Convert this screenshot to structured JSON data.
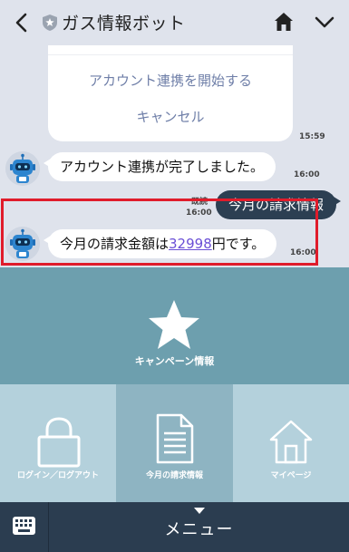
{
  "header": {
    "title": "ガス情報ボット"
  },
  "chat": {
    "card": {
      "action_start": "アカウント連携を開始する",
      "action_cancel": "キャンセル",
      "time": "15:59"
    },
    "messages": [
      {
        "from": "bot",
        "text": "アカウント連携が完了しました。",
        "time": "16:00"
      },
      {
        "from": "user",
        "text": "今月の請求情報",
        "read": "既読",
        "time": "16:00"
      },
      {
        "from": "bot",
        "text_before": "今月の請求金額は",
        "amount": "32998",
        "text_after": "円です。",
        "time": "16:00"
      }
    ]
  },
  "rich_menu": {
    "campaign": "キャンペーン情報",
    "login": "ログイン／ログアウト",
    "billing": "今月の請求情報",
    "mypage": "マイページ"
  },
  "bottom_bar": {
    "menu_label": "メニュー"
  },
  "colors": {
    "background": "#dfe3ec",
    "user_bubble": "#2c3f52",
    "highlight": "#e01c2b",
    "menu_top": "#6d9fae",
    "menu_cell": "#b4d1dc",
    "menu_cell_active": "#8eb4c2",
    "bottom_bar": "#2b3d50"
  }
}
